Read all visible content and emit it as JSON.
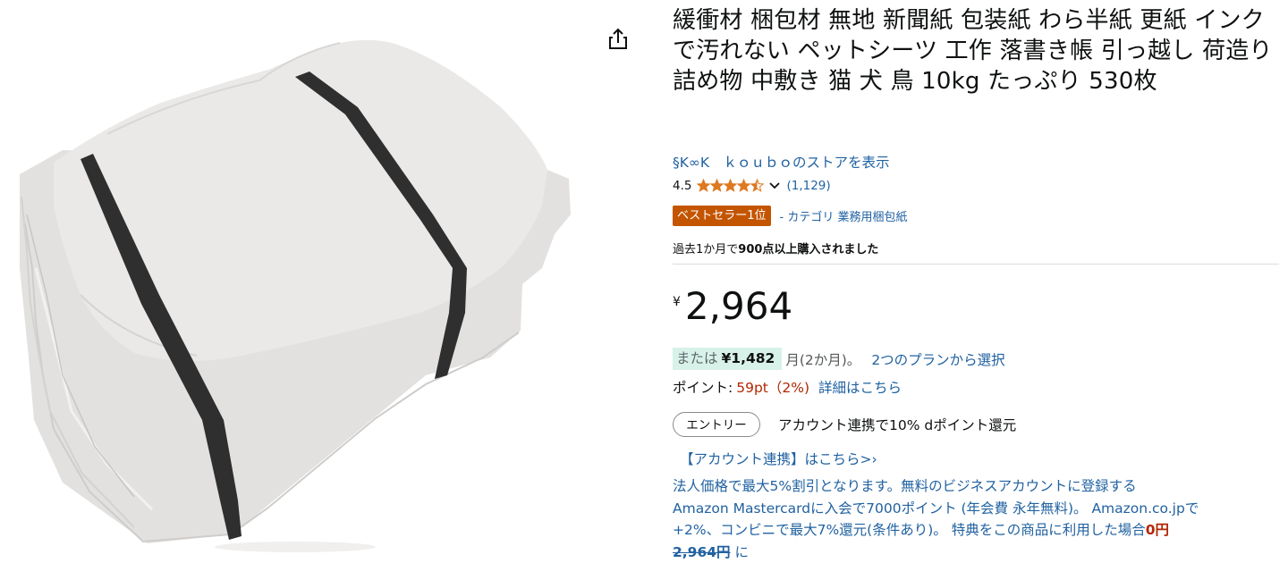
{
  "product": {
    "title": "緩衝材 梱包材 無地 新聞紙 包装紙 わら半紙 更紙 インクで汚れない ペットシーツ 工作 落書き帳 引っ越し 荷造り 詰め物 中敷き 猫 犬 鳥 10kg たっぷり 530枚",
    "image_icon": "stack-of-paper-with-straps-image",
    "share_icon": "share-icon"
  },
  "store": {
    "link": "§K∞K　ｋｏｕｂｏのストアを表示"
  },
  "rating": {
    "value": "4.5",
    "stars": 4.5,
    "count": "(1,129)",
    "star_color": "#de7921"
  },
  "badge": {
    "label": "ベストセラー1位",
    "category": "- カテゴリ 業務用梱包紙",
    "color": "#c45500"
  },
  "bought": {
    "prefix": "過去1か月で",
    "bold": "900点以上購入されました"
  },
  "price": {
    "symbol": "¥",
    "value": "2,964"
  },
  "installment": {
    "prefix": "または",
    "amount": "¥1,482",
    "suffix": "月(2か月)。",
    "link": "2つのプランから選択",
    "pill_color": "#d8f1e9"
  },
  "points": {
    "label": "ポイント:",
    "value": "59pt（2%)",
    "link": "詳細はこちら"
  },
  "entry": {
    "button": "エントリー",
    "text": "アカウント連携で10% dポイント還元"
  },
  "account_link": "【アカウント連携】はこちら>›",
  "business": {
    "line1": "法人価格で最大5%割引となります。無料のビジネスアカウントに登録する",
    "line2": "Amazon Mastercardに入会で7000ポイント (年会費 永年無料)。 Amazon.co.jpで",
    "line3": "+2%、コンビニで最大7%還元(条件あり)。 特典をこの商品に利用した場合",
    "line3_zero": "0円",
    "line4_strike": "2,964円",
    "line4_suffix": " に"
  },
  "colors": {
    "link": "#2162a1",
    "price_red": "#b12704",
    "text": "#0f1111"
  }
}
